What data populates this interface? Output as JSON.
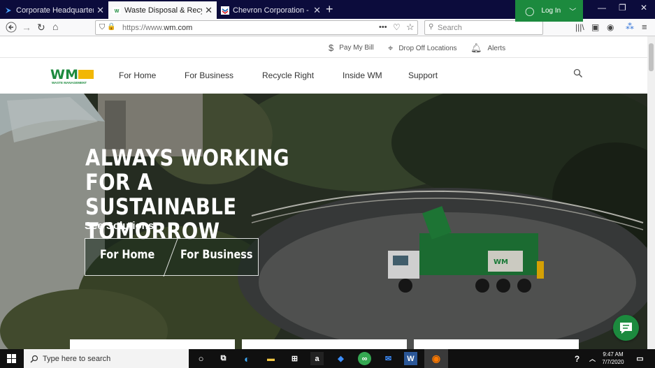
{
  "browser": {
    "tabs": [
      {
        "title": "Corporate Headquarters | Great",
        "favicon": "blue-arrow-favicon",
        "active": false
      },
      {
        "title": "Waste Disposal & Recycling | W",
        "favicon": "wm-favicon",
        "active": true
      },
      {
        "title": "Chevron Corporation - Human",
        "favicon": "chevron-favicon",
        "active": false
      }
    ],
    "url": {
      "scheme": "https://www.",
      "domain": "wm.com"
    },
    "search_placeholder": "Search",
    "url_actions": "•••"
  },
  "site": {
    "utility": {
      "pay_bill": "Pay My Bill",
      "drop_off": "Drop Off Locations",
      "alerts": "Alerts",
      "login": "Log In"
    },
    "logo_text": "WASTE MANAGEMENT",
    "nav": [
      "For Home",
      "For Business",
      "Recycle Right",
      "Inside WM",
      "Support"
    ],
    "hero": {
      "headline_line1": "ALWAYS WORKING FOR A",
      "headline_line2": "SUSTAINABLE TOMORROW",
      "solutions_label": "See Solutions:",
      "for_home": "For Home",
      "for_business": "For Business",
      "truck_logo": "WM"
    }
  },
  "taskbar": {
    "search_placeholder": "Type here to search",
    "time": "9:47 AM",
    "date": "7/7/2020"
  },
  "colors": {
    "brand_green": "#1c8a3e",
    "logo_yellow": "#f2b705",
    "tab_strip": "#0c0c3c"
  }
}
